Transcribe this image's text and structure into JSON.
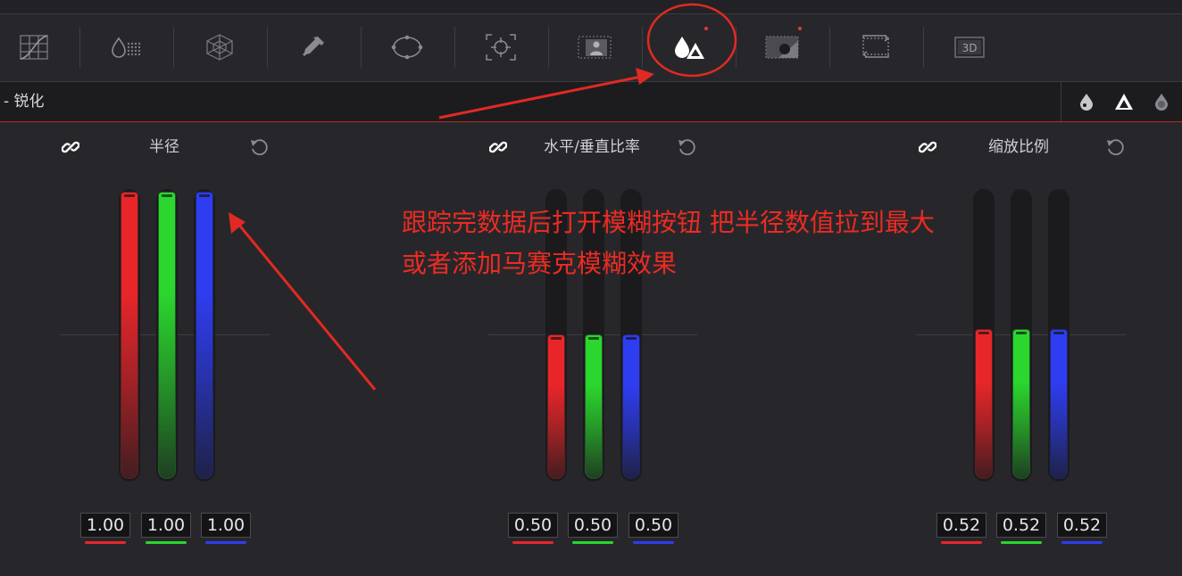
{
  "panel": {
    "title": "- 锐化"
  },
  "toolbar": {
    "tools": [
      {
        "icon": "curves-icon"
      },
      {
        "icon": "color-warper-icon"
      },
      {
        "icon": "color-warper-mesh-icon"
      },
      {
        "icon": "qualifier-eyedropper-icon"
      },
      {
        "icon": "power-window-icon"
      },
      {
        "icon": "tracker-icon"
      },
      {
        "icon": "magic-mask-icon"
      },
      {
        "icon": "blur-icon",
        "active": true
      },
      {
        "icon": "key-icon"
      },
      {
        "icon": "sizing-icon"
      },
      {
        "icon": "3d-icon",
        "label": "3D"
      }
    ]
  },
  "mode_buttons": [
    {
      "icon": "blur-drop-icon"
    },
    {
      "icon": "sharpen-triangle-icon"
    },
    {
      "icon": "mist-drop-icon"
    }
  ],
  "groups": [
    {
      "label": "半径",
      "values": [
        "1.00",
        "1.00",
        "1.00"
      ],
      "levels": [
        1.0,
        1.0,
        1.0
      ]
    },
    {
      "label": "水平/垂直比率",
      "values": [
        "0.50",
        "0.50",
        "0.50"
      ],
      "levels": [
        0.5,
        0.5,
        0.5
      ]
    },
    {
      "label": "缩放比例",
      "values": [
        "0.52",
        "0.52",
        "0.52"
      ],
      "levels": [
        0.52,
        0.52,
        0.52
      ]
    }
  ],
  "channel_colors": {
    "red": "#e8262a",
    "green": "#2bd62e",
    "blue": "#2e3df0"
  },
  "annotation": {
    "line1": "跟踪完数据后打开模糊按钮  把半径数值拉到最大",
    "line2": "或者添加马赛克模糊效果",
    "color": "#ec2b22"
  }
}
